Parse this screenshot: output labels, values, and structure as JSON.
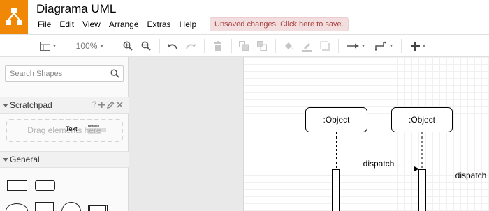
{
  "app": {
    "title": "Diagrama UML",
    "menu": [
      "File",
      "Edit",
      "View",
      "Arrange",
      "Extras",
      "Help"
    ],
    "unsaved_notice": "Unsaved changes. Click here to save.",
    "colors": {
      "brand": "#f08705",
      "notice_bg": "#f2dede",
      "notice_text": "#a94442"
    }
  },
  "toolbar": {
    "zoom": "100%",
    "icons": [
      "format-panel-icon",
      "zoom-in-icon",
      "zoom-out-icon",
      "undo-icon",
      "redo-icon",
      "delete-icon",
      "to-front-icon",
      "to-back-icon",
      "fill-color-icon",
      "line-color-icon",
      "shadow-icon",
      "connection-icon",
      "waypoints-icon",
      "insert-icon"
    ]
  },
  "sidebar": {
    "search_placeholder": "Search Shapes",
    "scratchpad": {
      "label": "Scratchpad",
      "help": "?",
      "drop_text": "Drag elements here"
    },
    "general": {
      "label": "General",
      "text_shape": "Text",
      "textbox_heading": "Heading"
    }
  },
  "diagram": {
    "objects": [
      ":Object",
      ":Object"
    ],
    "messages": [
      "dispatch",
      "dispatch"
    ]
  }
}
